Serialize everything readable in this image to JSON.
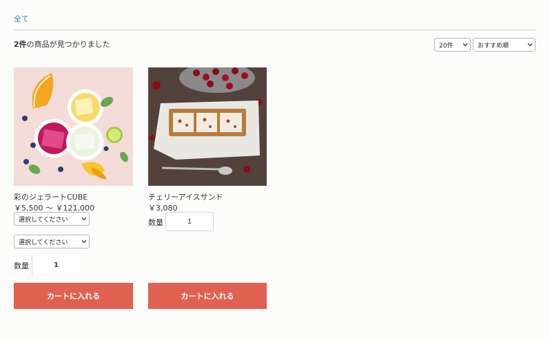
{
  "breadcrumb": {
    "all_label": "全て"
  },
  "result": {
    "count": "2件",
    "suffix": "の商品が見つかりました"
  },
  "controls": {
    "per_page": "20件",
    "sort": "おすすめ順"
  },
  "products": [
    {
      "name": "彩のジェラートCUBE",
      "price": "￥5,500 ～ ￥121,000",
      "option1": "選択してください",
      "option2": "選択してください",
      "qty_label": "数量",
      "qty": "1",
      "cart_label": "カートに入れる"
    },
    {
      "name": "チェリーアイスサンド",
      "price": "￥3,080",
      "qty_label": "数量",
      "qty": "1",
      "cart_label": "カートに入れる"
    }
  ],
  "colors": {
    "accent": "#e06152",
    "link": "#1a8ab5"
  }
}
